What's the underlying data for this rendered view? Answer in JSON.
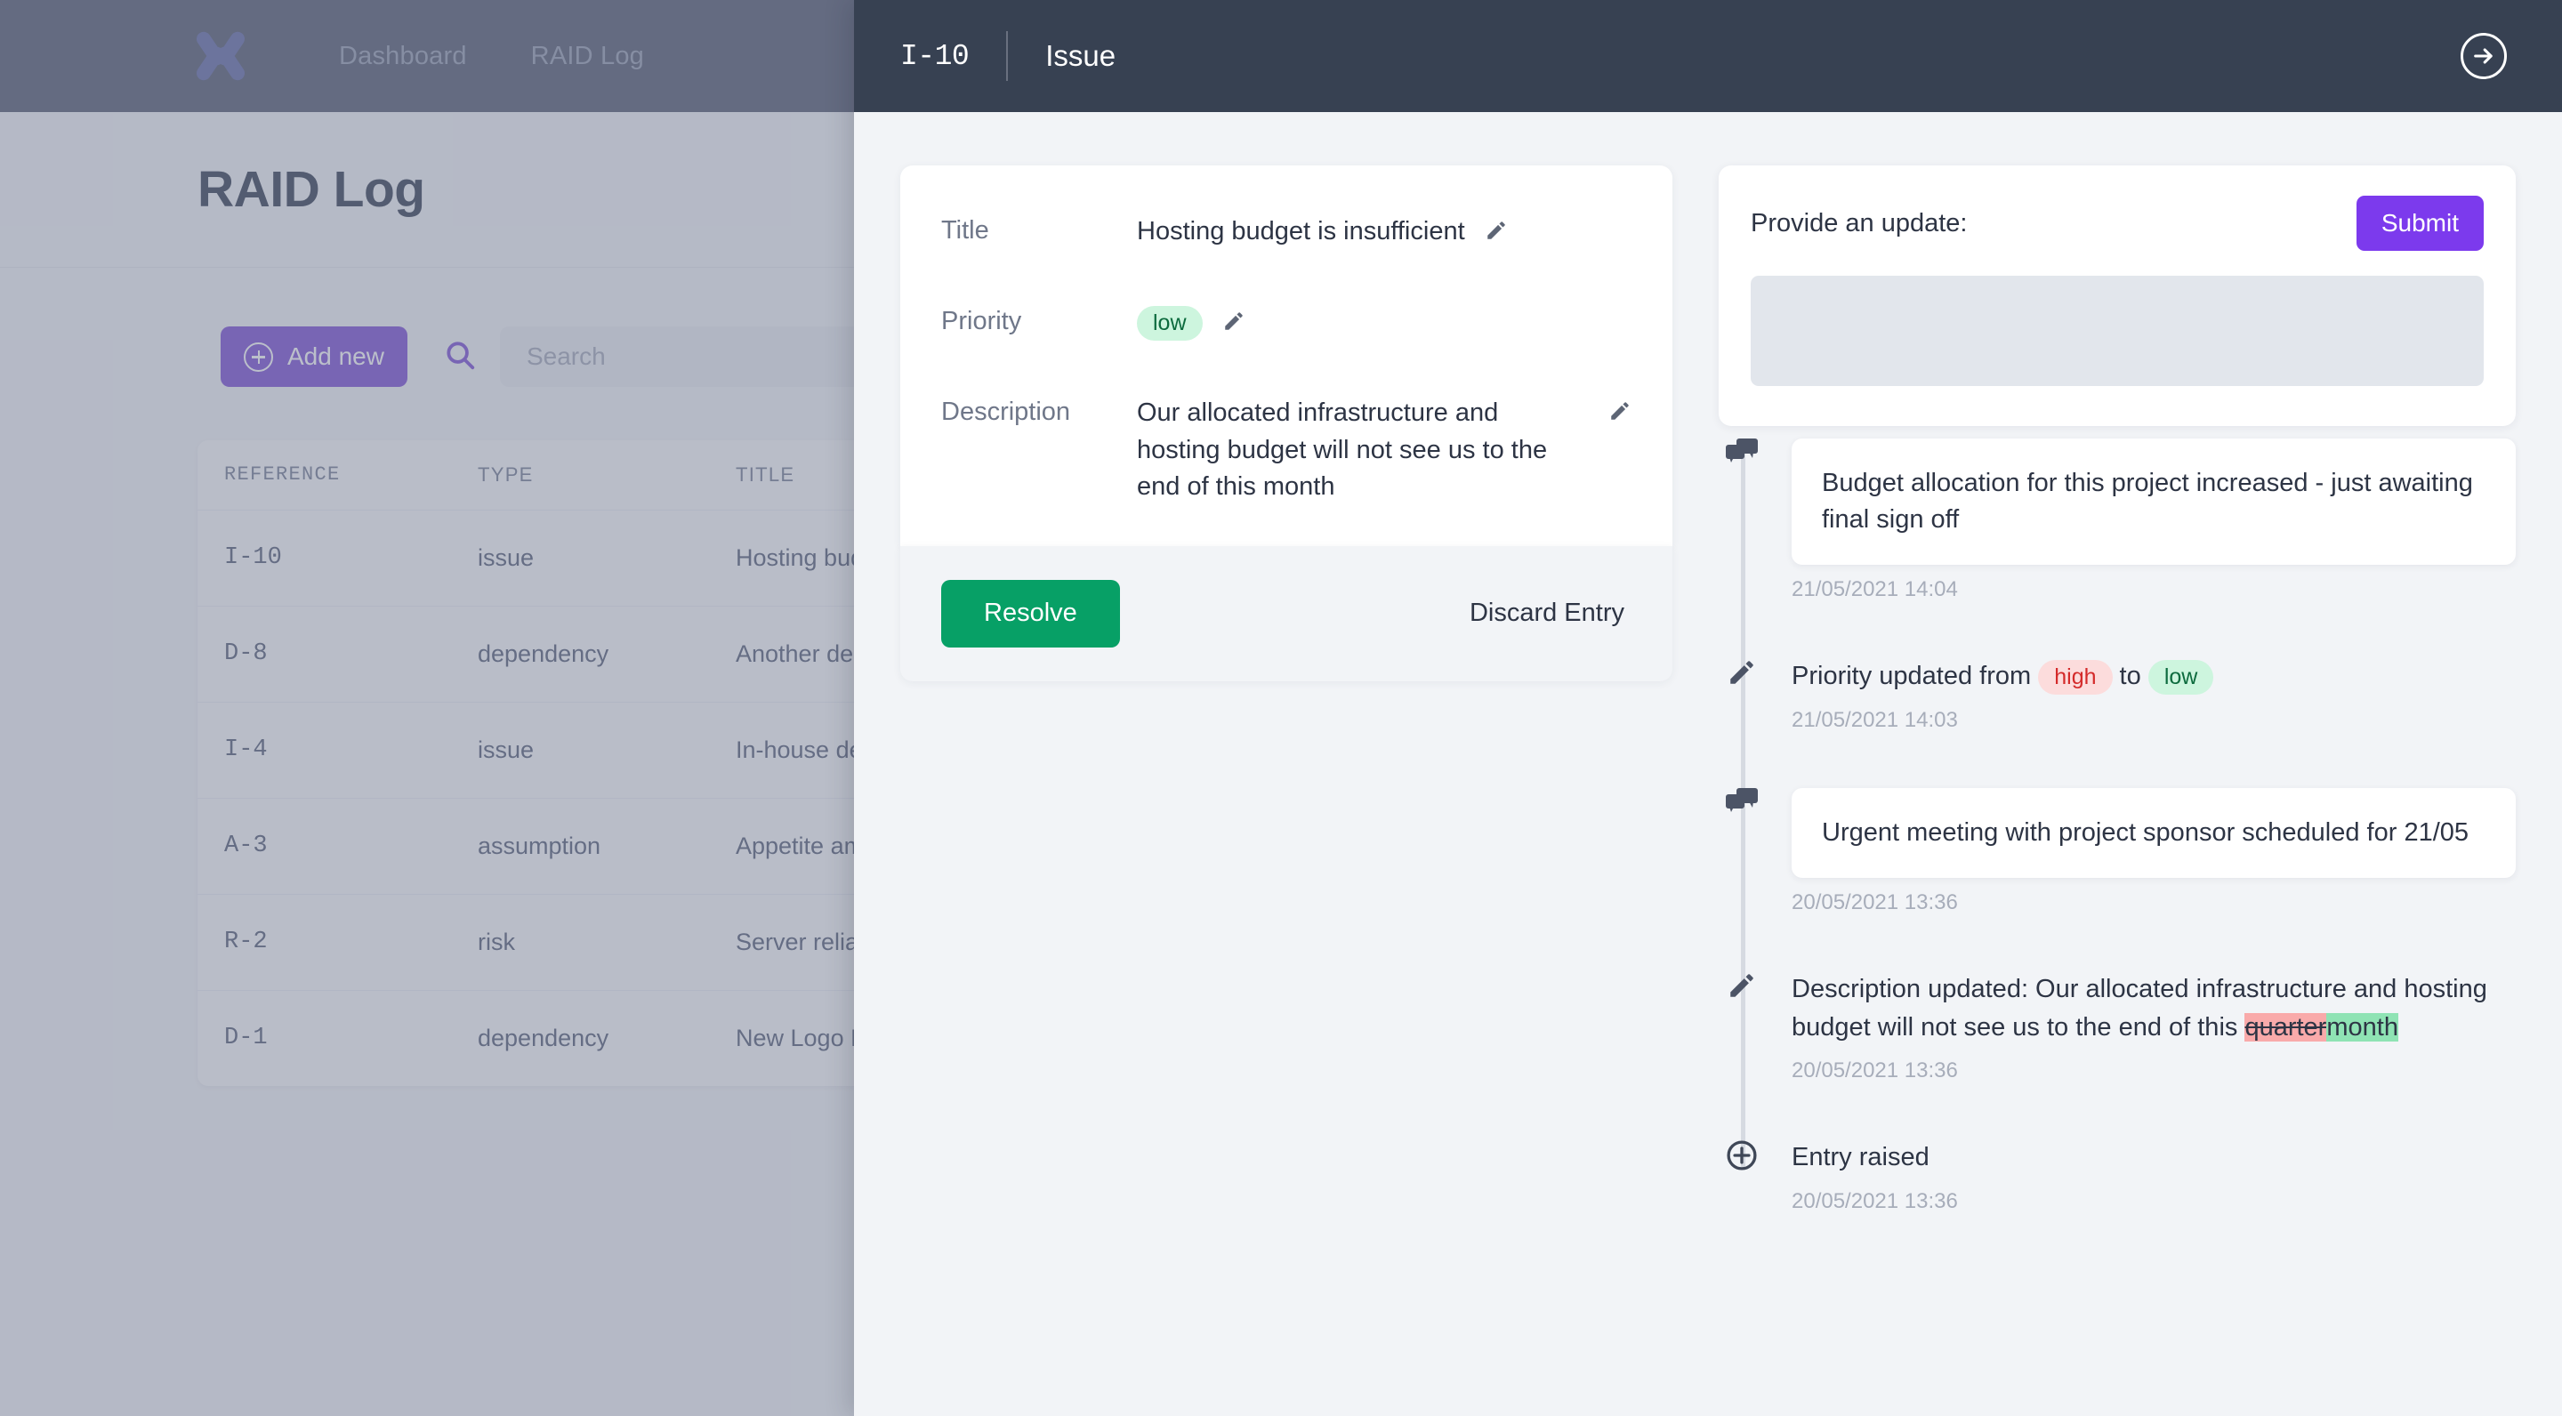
{
  "background": {
    "nav": {
      "logo_icon": "x-logo-icon",
      "links": [
        "Dashboard",
        "RAID Log"
      ]
    },
    "page_title": "RAID Log",
    "toolbar": {
      "add_label": "Add new",
      "search_icon": "search-icon",
      "search_placeholder": "Search",
      "search_value": ""
    },
    "table": {
      "columns": [
        "REFERENCE",
        "TYPE",
        "TITLE"
      ],
      "rows": [
        {
          "reference": "I-10",
          "type": "issue",
          "title": "Hosting bud"
        },
        {
          "reference": "D-8",
          "type": "dependency",
          "title": "Another dep"
        },
        {
          "reference": "I-4",
          "type": "issue",
          "title": "In-house de"
        },
        {
          "reference": "A-3",
          "type": "assumption",
          "title": "Appetite am"
        },
        {
          "reference": "R-2",
          "type": "risk",
          "title": "Server relial"
        },
        {
          "reference": "D-1",
          "type": "dependency",
          "title": "New Logo D"
        }
      ]
    }
  },
  "modal": {
    "header": {
      "reference": "I-10",
      "entry_type": "Issue",
      "next_icon": "arrow-right-circle-icon"
    },
    "detail": {
      "fields": [
        {
          "label": "Title",
          "value": "Hosting budget is insufficient"
        },
        {
          "label": "Priority",
          "value": "low"
        },
        {
          "label": "Description",
          "value": "Our allocated infrastructure and hosting budget will not see us to the end of this month"
        }
      ],
      "edit_icon": "pencil-icon",
      "resolve_label": "Resolve",
      "discard_label": "Discard Entry"
    },
    "update": {
      "label": "Provide an update:",
      "submit_label": "Submit",
      "textarea_value": "",
      "textarea_placeholder": ""
    },
    "timeline": [
      {
        "icon": "comment-icon",
        "kind": "comment",
        "text": "Budget allocation for this project increased - just awaiting final sign off",
        "timestamp": "21/05/2021 14:04"
      },
      {
        "icon": "pencil-icon",
        "kind": "priority-change",
        "prefix": "Priority updated from ",
        "from": "high",
        "middle": " to ",
        "to": "low",
        "timestamp": "21/05/2021 14:03"
      },
      {
        "icon": "comment-icon",
        "kind": "comment",
        "text": "Urgent meeting with project sponsor scheduled for 21/05",
        "timestamp": "20/05/2021 13:36"
      },
      {
        "icon": "pencil-icon",
        "kind": "description-change",
        "prefix": "Description updated: Our allocated infrastructure and hosting budget will not see us to the end of this ",
        "removed": "quarter",
        "added": "month",
        "timestamp": "20/05/2021 13:36"
      },
      {
        "icon": "plus-circle-icon",
        "kind": "raised",
        "text": "Entry raised",
        "timestamp": "20/05/2021 13:36"
      }
    ]
  },
  "colors": {
    "brand_purple": "#8055d6",
    "submit_purple": "#7c3aed",
    "resolve_green": "#07a066",
    "badge_low_bg": "#cdf5de",
    "badge_low_text": "#0d6b3e",
    "badge_high_bg": "#fcdcdc",
    "badge_high_text": "#d42a2a",
    "modal_header": "#374152",
    "nav_bar": "#5b6176",
    "diff_removed_bg": "#f9aaaa",
    "diff_added_bg": "#8fe3b4"
  }
}
